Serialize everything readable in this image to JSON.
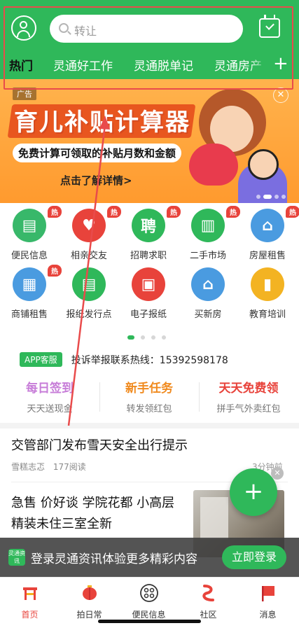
{
  "search": {
    "placeholder": "转让"
  },
  "tabs": [
    "热门",
    "灵通好工作",
    "灵通脱单记",
    "灵通房产"
  ],
  "banner": {
    "ad_tag": "广告",
    "title": "育儿补贴计算器",
    "subtitle": "免费计算可领取的补贴月数和金额",
    "cta": "点击了解详情>"
  },
  "grid": [
    {
      "label": "便民信息",
      "hot": "热",
      "icon": "document-icon",
      "color": "#38b86a"
    },
    {
      "label": "相亲交友",
      "hot": "热",
      "icon": "heart-love-icon",
      "color": "#e8433b"
    },
    {
      "label": "招聘求职",
      "hot": "热",
      "icon": "recruit-icon",
      "color": "#2fb85a"
    },
    {
      "label": "二手市场",
      "hot": "热",
      "icon": "shop-shelf-icon",
      "color": "#2fb85a"
    },
    {
      "label": "房屋租售",
      "hot": "热",
      "icon": "house-yen-icon",
      "color": "#4a9be0"
    },
    {
      "label": "商铺租售",
      "hot": "热",
      "icon": "storefront-icon",
      "color": "#4a9be0"
    },
    {
      "label": "报纸发行点",
      "hot": "",
      "icon": "newspaper-stack-icon",
      "color": "#2fb85a"
    },
    {
      "label": "电子报纸",
      "hot": "",
      "icon": "e-paper-icon",
      "color": "#e8433b"
    },
    {
      "label": "买新房",
      "hot": "",
      "icon": "new-house-icon",
      "color": "#4a9be0"
    },
    {
      "label": "教育培训",
      "hot": "",
      "icon": "book-icon",
      "color": "#f3b322"
    }
  ],
  "hotline": {
    "badge": "APP客服",
    "text": "投诉举报联系热线：15392598178"
  },
  "tasks": [
    {
      "title": "每日签到",
      "sub": "天天送现金",
      "color": "#c77dd8"
    },
    {
      "title": "新手任务",
      "sub": "转发领红包",
      "color": "#f08a1e"
    },
    {
      "title": "天天免费领",
      "sub": "拼手气外卖红包",
      "color": "#e8433b"
    }
  ],
  "news": [
    {
      "title": "交管部门发布雪天安全出行提示",
      "source": "雪糕志忑",
      "reads": "177阅读",
      "time": "3分钟前"
    },
    {
      "title": "急售 价好谈 学院花都 小高层精装未住三室全新"
    }
  ],
  "login_bar": {
    "logo": "灵通资讯",
    "text": "登录灵通资讯体验更多精彩内容",
    "button": "立即登录"
  },
  "bottom_nav": [
    {
      "label": "首页",
      "icon": "home-gate-icon",
      "active": true
    },
    {
      "label": "拍日常",
      "icon": "lantern-icon",
      "active": false
    },
    {
      "label": "便民信息",
      "icon": "grid-circle-icon",
      "active": false
    },
    {
      "label": "社区",
      "icon": "community-icon",
      "active": false
    },
    {
      "label": "消息",
      "icon": "message-flag-icon",
      "active": false
    }
  ],
  "colors": {
    "brand_green": "#2fb85a",
    "annotation_red": "#e94b4b",
    "hot_red": "#e8433b"
  }
}
